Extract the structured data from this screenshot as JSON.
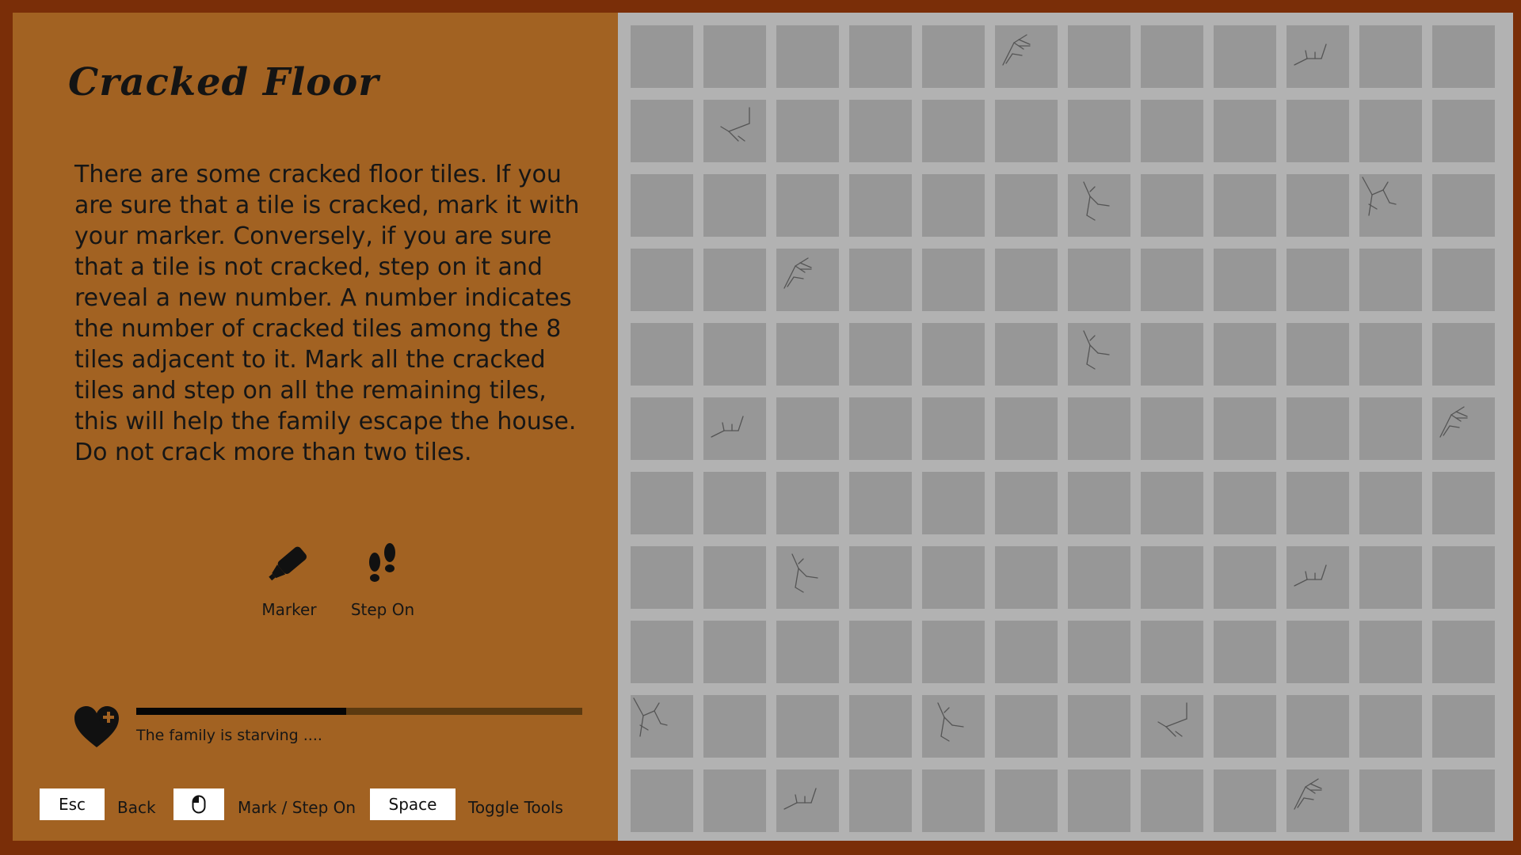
{
  "title": "Cracked Floor",
  "instructions": "There are some cracked floor tiles. If you are sure that a tile is cracked, mark it with your marker. Conversely, if you are sure that a tile is not cracked, step on it and reveal a new number. A number indicates the number of cracked tiles among the 8 tiles adjacent to it. Mark all the cracked tiles and step on all the remaining tiles, this will help the family escape the house. Do not crack more than two tiles.",
  "tools": [
    {
      "label": "Marker",
      "icon": "marker-icon"
    },
    {
      "label": "Step On",
      "icon": "footprints-icon"
    }
  ],
  "status": {
    "icon": "heart-plus-icon",
    "text": "The family is starving ....",
    "progress": 0.47
  },
  "controls": [
    {
      "key": "Esc",
      "label": "Back"
    },
    {
      "key_icon": "mouse-icon",
      "label": "Mark / Step On"
    },
    {
      "key": "Space",
      "label": "Toggle Tools"
    }
  ],
  "grid": {
    "columns": 12,
    "rows": 11,
    "cracked_tiles": [
      [
        0,
        5,
        "A"
      ],
      [
        0,
        9,
        "C"
      ],
      [
        1,
        1,
        "B"
      ],
      [
        2,
        6,
        "D"
      ],
      [
        2,
        10,
        "E"
      ],
      [
        3,
        2,
        "A"
      ],
      [
        4,
        6,
        "D"
      ],
      [
        5,
        1,
        "C"
      ],
      [
        5,
        11,
        "A"
      ],
      [
        7,
        2,
        "D"
      ],
      [
        7,
        9,
        "C"
      ],
      [
        9,
        0,
        "E"
      ],
      [
        9,
        4,
        "D"
      ],
      [
        9,
        7,
        "B"
      ],
      [
        10,
        2,
        "C"
      ],
      [
        10,
        9,
        "A"
      ]
    ]
  },
  "colors": {
    "frame": "#7a2e08",
    "panel": "#a26222",
    "board": "#b2b2b2",
    "tile": "#979797",
    "crack": "#555555",
    "bar_fill": "#060606",
    "bar_track": "#5c3a10"
  }
}
